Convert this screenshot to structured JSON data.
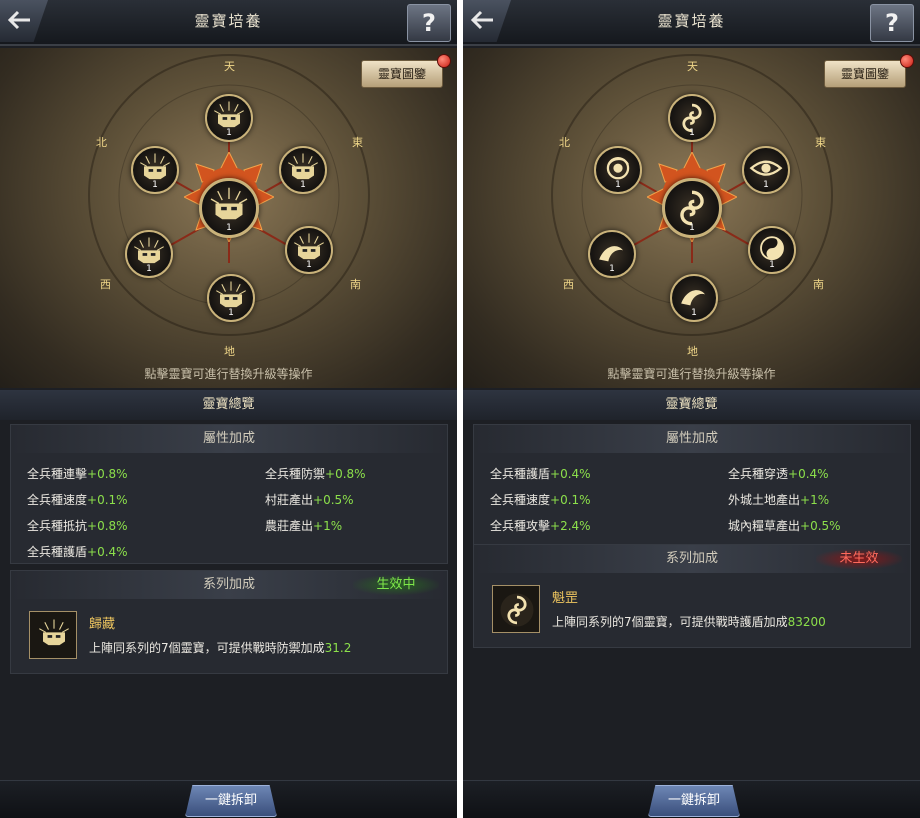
{
  "panels": [
    {
      "title": "靈寶培養",
      "help_label": "?",
      "catalog_label": "靈寶圖鑒",
      "directions": {
        "heaven": "天",
        "earth": "地",
        "north": "北",
        "east": "東",
        "west": "西",
        "south": "南"
      },
      "slots": [
        {
          "id": "top",
          "icon": "guardian-icon",
          "level": "1"
        },
        {
          "id": "upper-left",
          "icon": "guardian-icon",
          "level": "1"
        },
        {
          "id": "upper-right",
          "icon": "guardian-icon",
          "level": "1"
        },
        {
          "id": "center",
          "icon": "guardian-icon",
          "level": "1"
        },
        {
          "id": "lower-left",
          "icon": "guardian-icon",
          "level": "1"
        },
        {
          "id": "lower-right",
          "icon": "guardian-icon",
          "level": "1"
        },
        {
          "id": "bottom",
          "icon": "guardian-icon",
          "level": "1"
        }
      ],
      "hint": "點擊靈寶可進行替換升級等操作",
      "overview_title": "靈寶總覽",
      "attr_title": "屬性加成",
      "attributes": [
        {
          "label": "全兵種連擊",
          "value": "+0.8%"
        },
        {
          "label": "全兵種防禦",
          "value": "+0.8%"
        },
        {
          "label": "全兵種速度",
          "value": "+0.1%"
        },
        {
          "label": "村莊產出",
          "value": "+0.5%"
        },
        {
          "label": "全兵種抵抗",
          "value": "+0.8%"
        },
        {
          "label": "農莊產出",
          "value": "+1%"
        },
        {
          "label": "全兵種護盾",
          "value": "+0.4%"
        }
      ],
      "series_title": "系列加成",
      "series_status": "生效中",
      "series_active": true,
      "series_icon": "guardian-icon",
      "series_name": "歸藏",
      "series_desc": "上陣同系列的7個靈寶，可提供戰時防禦加成",
      "series_value": "31.2",
      "unload_label": "一鍵拆卸"
    },
    {
      "title": "靈寶培養",
      "help_label": "?",
      "catalog_label": "靈寶圖鑒",
      "directions": {
        "heaven": "天",
        "earth": "地",
        "north": "北",
        "east": "東",
        "west": "西",
        "south": "南"
      },
      "slots": [
        {
          "id": "top",
          "icon": "swirl-icon",
          "level": "1"
        },
        {
          "id": "upper-left",
          "icon": "vortex-icon",
          "level": "1"
        },
        {
          "id": "upper-right",
          "icon": "eye-icon",
          "level": "1"
        },
        {
          "id": "center",
          "icon": "swirl-icon",
          "level": "1"
        },
        {
          "id": "lower-left",
          "icon": "wave-icon",
          "level": "1"
        },
        {
          "id": "lower-right",
          "icon": "yin-yang-icon",
          "level": "1"
        },
        {
          "id": "bottom",
          "icon": "wave-icon",
          "level": "1"
        }
      ],
      "hint": "點擊靈寶可進行替換升級等操作",
      "overview_title": "靈寶總覽",
      "attr_title": "屬性加成",
      "attributes": [
        {
          "label": "全兵種護盾",
          "value": "+0.4%"
        },
        {
          "label": "全兵種穿透",
          "value": "+0.4%"
        },
        {
          "label": "全兵種速度",
          "value": "+0.1%"
        },
        {
          "label": "外城土地產出",
          "value": "+1%"
        },
        {
          "label": "全兵種攻擊",
          "value": "+2.4%"
        },
        {
          "label": "城內糧草產出",
          "value": "+0.5%"
        }
      ],
      "series_title": "系列加成",
      "series_status": "未生效",
      "series_active": false,
      "series_icon": "swirl-icon",
      "series_name": "魁罡",
      "series_desc": "上陣同系列的7個靈寶，可提供戰時護盾加成",
      "series_value": "83200",
      "unload_label": "一鍵拆卸"
    }
  ]
}
